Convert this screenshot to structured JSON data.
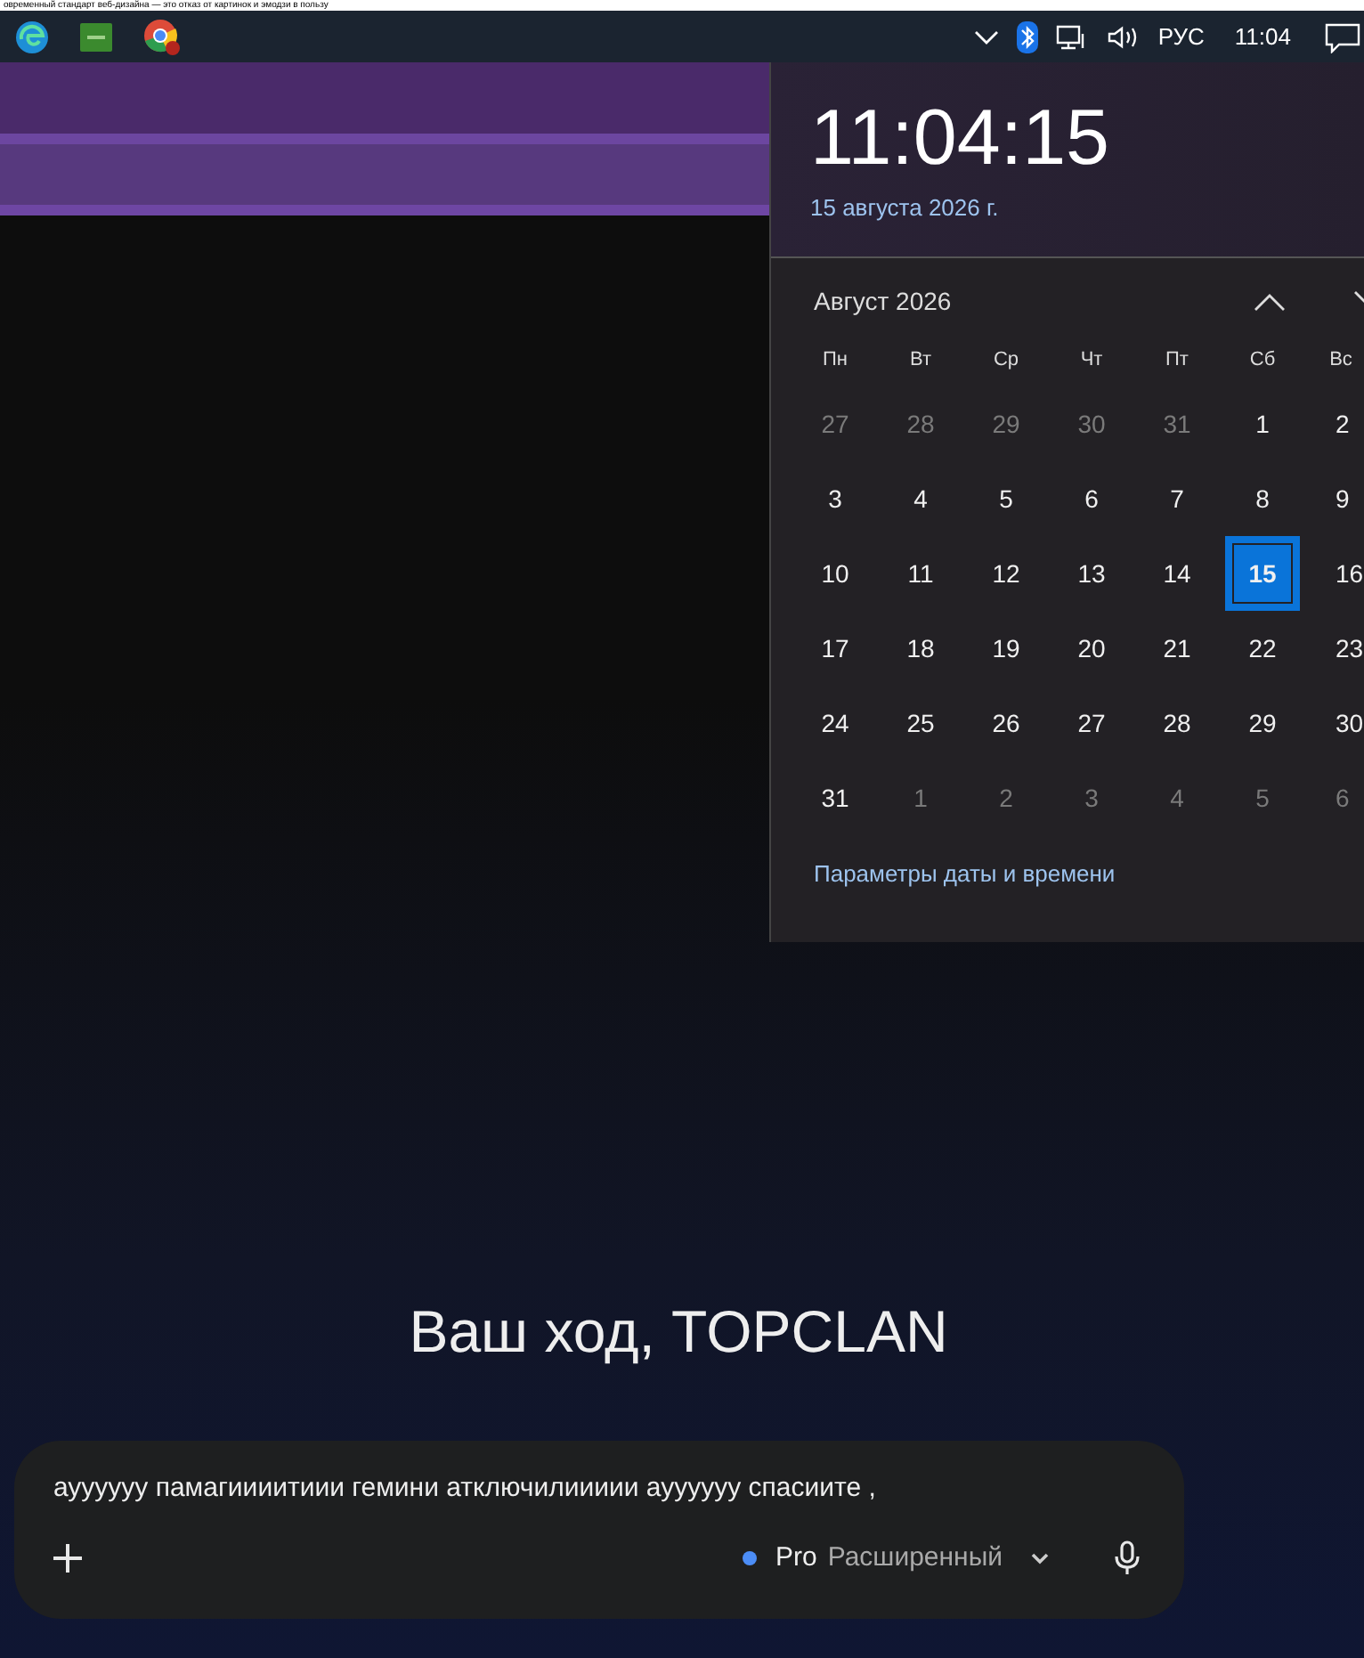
{
  "browser_tab_text": "овременный стандарт веб-дизайна — это отказ от картинок и эмодзи в пользу",
  "taskbar": {
    "apps": [
      {
        "kind": "edge"
      },
      {
        "kind": "green"
      },
      {
        "kind": "chrome",
        "badge": true
      }
    ],
    "language": "РУС",
    "time": "11:04"
  },
  "clock_flyout": {
    "time": "11:04:15",
    "date": "15 августа 2026 г.",
    "month": "Август 2026",
    "weekdays": [
      "Пн",
      "Вт",
      "Ср",
      "Чт",
      "Пт",
      "Сб",
      "Вс"
    ],
    "days": [
      {
        "label": "27",
        "dim": true,
        "selected": false
      },
      {
        "label": "28",
        "dim": true,
        "selected": false
      },
      {
        "label": "29",
        "dim": true,
        "selected": false
      },
      {
        "label": "30",
        "dim": true,
        "selected": false
      },
      {
        "label": "31",
        "dim": true,
        "selected": false
      },
      {
        "label": "1",
        "dim": false,
        "selected": false
      },
      {
        "label": "2",
        "dim": false,
        "selected": false
      },
      {
        "label": "3",
        "dim": false,
        "selected": false
      },
      {
        "label": "4",
        "dim": false,
        "selected": false
      },
      {
        "label": "5",
        "dim": false,
        "selected": false
      },
      {
        "label": "6",
        "dim": false,
        "selected": false
      },
      {
        "label": "7",
        "dim": false,
        "selected": false
      },
      {
        "label": "8",
        "dim": false,
        "selected": false
      },
      {
        "label": "9",
        "dim": false,
        "selected": false
      },
      {
        "label": "10",
        "dim": false,
        "selected": false
      },
      {
        "label": "11",
        "dim": false,
        "selected": false
      },
      {
        "label": "12",
        "dim": false,
        "selected": false
      },
      {
        "label": "13",
        "dim": false,
        "selected": false
      },
      {
        "label": "14",
        "dim": false,
        "selected": false
      },
      {
        "label": "15",
        "dim": false,
        "selected": true
      },
      {
        "label": "16",
        "dim": false,
        "selected": false
      },
      {
        "label": "17",
        "dim": false,
        "selected": false
      },
      {
        "label": "18",
        "dim": false,
        "selected": false
      },
      {
        "label": "19",
        "dim": false,
        "selected": false
      },
      {
        "label": "20",
        "dim": false,
        "selected": false
      },
      {
        "label": "21",
        "dim": false,
        "selected": false
      },
      {
        "label": "22",
        "dim": false,
        "selected": false
      },
      {
        "label": "23",
        "dim": false,
        "selected": false
      },
      {
        "label": "24",
        "dim": false,
        "selected": false
      },
      {
        "label": "25",
        "dim": false,
        "selected": false
      },
      {
        "label": "26",
        "dim": false,
        "selected": false
      },
      {
        "label": "27",
        "dim": false,
        "selected": false
      },
      {
        "label": "28",
        "dim": false,
        "selected": false
      },
      {
        "label": "29",
        "dim": false,
        "selected": false
      },
      {
        "label": "30",
        "dim": false,
        "selected": false
      },
      {
        "label": "31",
        "dim": false,
        "selected": false
      },
      {
        "label": "1",
        "dim": true,
        "selected": false
      },
      {
        "label": "2",
        "dim": true,
        "selected": false
      },
      {
        "label": "3",
        "dim": true,
        "selected": false
      },
      {
        "label": "4",
        "dim": true,
        "selected": false
      },
      {
        "label": "5",
        "dim": true,
        "selected": false
      },
      {
        "label": "6",
        "dim": true,
        "selected": false
      }
    ],
    "settings_link": "Параметры даты и времени"
  },
  "greeting": "Ваш ход, TOPCLAN",
  "prompt": {
    "value": "ауууууу памагиииитиии гемини атключилиииии ауууууу спасиите ,",
    "model": {
      "name": "Pro",
      "mode": "Расширенный",
      "color": "#4c8df6"
    }
  }
}
